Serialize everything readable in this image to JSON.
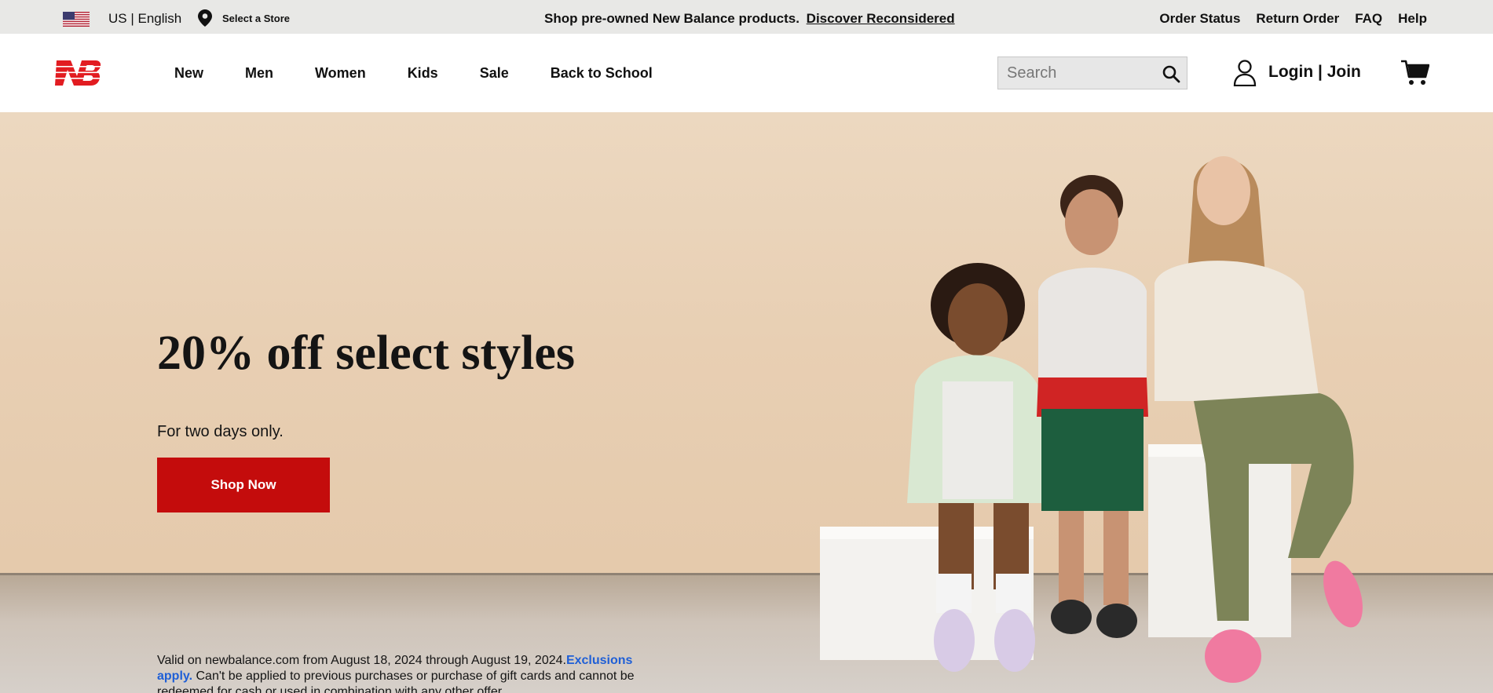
{
  "utility": {
    "locale": "US | English",
    "store": "Select a Store",
    "promo_text": "Shop pre-owned New Balance products.",
    "promo_link": "Discover Reconsidered",
    "links": [
      "Order Status",
      "Return Order",
      "FAQ",
      "Help"
    ]
  },
  "header": {
    "nav": [
      "New",
      "Men",
      "Women",
      "Kids",
      "Sale",
      "Back to School"
    ],
    "search_placeholder": "Search",
    "account": "Login | Join"
  },
  "hero": {
    "headline": "20% off select styles",
    "subtext": "For two days only.",
    "cta": "Shop Now",
    "fineprint_text": "Valid on newbalance.com from August 18, 2024 through August 19, 2024.",
    "fineprint_link": "Exclusions apply.",
    "fineprint_rest": " Can't be applied to previous purchases or purchase of gift cards and cannot be redeemed for cash or used in combination with any other offer."
  },
  "colors": {
    "brand_red": "#c40c0c",
    "link_blue": "#1f5fd6",
    "utility_bg": "#e8e8e6",
    "hero_bg": "#e8cfb3"
  },
  "icons": [
    "us-flag-icon",
    "location-pin-icon",
    "nb-logo",
    "search-icon",
    "user-icon",
    "cart-icon"
  ]
}
